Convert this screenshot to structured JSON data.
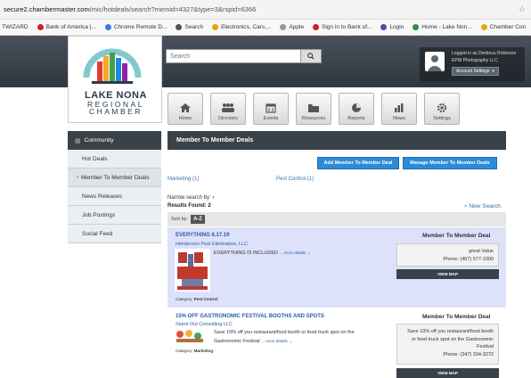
{
  "browser": {
    "url_host": "secure2.chambermaster.com",
    "url_path": "/mic/hotdeals/search?memid=4327&type=3&rspid=6366",
    "bookmarks": [
      {
        "label": "TWIZARD",
        "color": "#888888"
      },
      {
        "label": "Bank of America |...",
        "color": "#d0202a"
      },
      {
        "label": "Chrome Remote D...",
        "color": "#3b7bd8"
      },
      {
        "label": "Search",
        "color": "#555555"
      },
      {
        "label": "Electronics, Cars,...",
        "color": "#e5a800"
      },
      {
        "label": "Apple",
        "color": "#999999"
      },
      {
        "label": "Sign in to Bank of...",
        "color": "#d0202a"
      },
      {
        "label": "Login",
        "color": "#6a3fb5"
      },
      {
        "label": "Home - Lake Non...",
        "color": "#2f8f3f"
      },
      {
        "label": "Chamber Con",
        "color": "#e5a800"
      }
    ]
  },
  "header": {
    "search_placeholder": "Search",
    "user": {
      "line1": "Logged in as Denitsuu Robinson",
      "line2": "EPW Photography LLC",
      "account_button": "Account Settings"
    }
  },
  "logo": {
    "line1": "LAKE NONA",
    "line2": "REGIONAL",
    "line3": "CHAMBER",
    "colors": [
      "#e53935",
      "#f9a825",
      "#43a047",
      "#1e88e5",
      "#8e24aa"
    ]
  },
  "nav": {
    "items": [
      {
        "label": "Home",
        "icon": "home-icon"
      },
      {
        "label": "Directory",
        "icon": "people-icon"
      },
      {
        "label": "Events",
        "icon": "calendar-icon"
      },
      {
        "label": "Resources",
        "icon": "folder-icon"
      },
      {
        "label": "Reports",
        "icon": "pie-chart-icon"
      },
      {
        "label": "News",
        "icon": "bar-chart-icon"
      },
      {
        "label": "Settings",
        "icon": "gear-icon"
      }
    ]
  },
  "sidebar": {
    "heading": "Community",
    "items": [
      {
        "label": "Hot Deals"
      },
      {
        "label": "Member To Member Deals"
      },
      {
        "label": "News Releases"
      },
      {
        "label": "Job Postings"
      },
      {
        "label": "Social Feed"
      }
    ]
  },
  "main": {
    "title": "Member To Member Deals",
    "add_button": "Add Member To Member Deal",
    "manage_button": "Manage Member To Member Deals",
    "filter_marketing": "Marketing (1)",
    "filter_pest": "Pest Control (1)",
    "narrow_label": "Narrow search by:",
    "results_label": "Results Found: 2",
    "new_search": "New Search",
    "sort_label": "Sort by:",
    "sort_value": "A-Z"
  },
  "listings": [
    {
      "title": "EVERYTHING 8.17.19",
      "company": "Henderson Pest Elimination, LLC",
      "desc": "EVERYTHING IS INCLUDED",
      "more": "... more details →",
      "category_label": "Category:",
      "category": "Pest Control",
      "deal_type": "Member To Member Deal",
      "info_line1": "great Value",
      "phone": "Phone: (407) 577-1900",
      "view_map": "VIEW MAP"
    },
    {
      "title": "15% OFF GASTRONOMIC FESTIVAL BOOTHS AND SPOTS",
      "company": "Stand Out Consulting LLC",
      "desc_line1": "Save 10% off you restaurant/food booth or food truck spot on the",
      "desc_line2": "Gastronomic Festival",
      "more": "... more details →",
      "category_label": "Category:",
      "category": "Marketing",
      "deal_type": "Member To Member Deal",
      "info_line1": "Save 10% off you restaurant/food booth",
      "info_line2": "or food truck spot on the Gastronomic",
      "info_line3": "Festival",
      "phone": "Phone: (347) 334-3272",
      "view_map": "VIEW MAP"
    }
  ]
}
